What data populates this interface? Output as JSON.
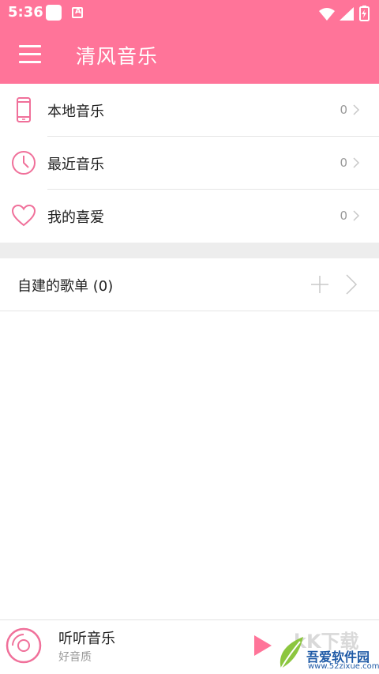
{
  "status_bar": {
    "time": "5:36",
    "notif_a": "A"
  },
  "app_bar": {
    "title": "清风音乐"
  },
  "menu": [
    {
      "label": "本地音乐",
      "count": "0",
      "icon": "phone-icon"
    },
    {
      "label": "最近音乐",
      "count": "0",
      "icon": "clock-icon"
    },
    {
      "label": "我的喜爱",
      "count": "0",
      "icon": "heart-icon"
    }
  ],
  "playlist": {
    "label": "自建的歌单 (0)"
  },
  "player": {
    "title": "听听音乐",
    "subtitle": "好音质"
  },
  "watermark": {
    "ghost": "kK下载",
    "text": "吾爱软件园",
    "url": "www.52zixue.com"
  },
  "colors": {
    "accent": "#ff7499",
    "icon_pink": "#f0709a",
    "text": "#222222",
    "muted": "#999999",
    "divider": "#e6e6e6"
  }
}
